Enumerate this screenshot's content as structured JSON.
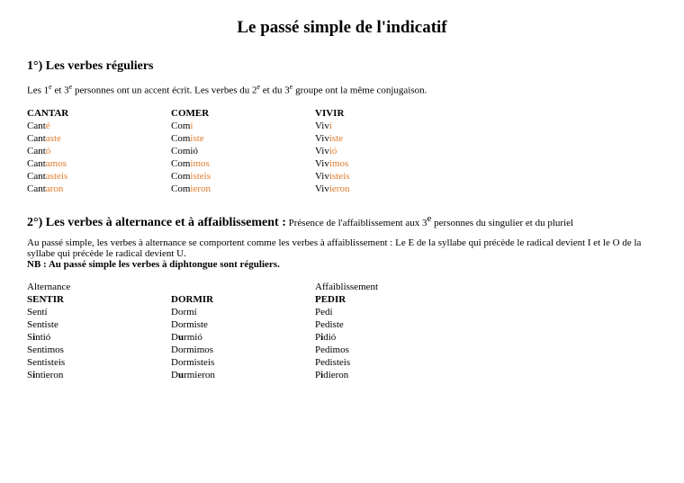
{
  "title": "Le passé simple de l'indicatif",
  "section1": {
    "heading": "1°) Les verbes réguliers",
    "intro_a": "Les 1",
    "intro_b": " et 3",
    "intro_c": " personnes ont un accent écrit. Les verbes du 2",
    "intro_d": " et du 3",
    "intro_e": " groupe ont la même conjugaison.",
    "sup_e": "e",
    "verbs": {
      "cantar": {
        "head": "CANTAR",
        "r1s": "Cant",
        "r1a": "é",
        "r2s": "Cant",
        "r2a": "aste",
        "r3s": "Cant",
        "r3a": "ó",
        "r4s": "Cant",
        "r4a": "amos",
        "r5s": "Cant",
        "r5a": "asteis",
        "r6s": "Cant",
        "r6a": "aron"
      },
      "comer": {
        "head": "COMER",
        "r1s": "Com",
        "r1a": "í",
        "r2s": "Com",
        "r2a": "iste",
        "r3s": "Comió",
        "r3a": "",
        "r4s": "Com",
        "r4a": "imos",
        "r5s": "Com",
        "r5a": "isteis",
        "r6s": "Com",
        "r6a": "ieron"
      },
      "vivir": {
        "head": "VIVIR",
        "r1s": "Viv",
        "r1a": "í",
        "r2s": "Viv",
        "r2a": "iste",
        "r3s": "Viv",
        "r3a": "ió",
        "r4s": "Viv",
        "r4a": "imos",
        "r5s": "Viv",
        "r5a": "isteis",
        "r6s": "Viv",
        "r6a": "ieron"
      }
    }
  },
  "section2": {
    "heading": "2°) Les verbes à alternance et à affaiblissement :",
    "sub_a": " Présence de l'affaiblissement aux 3",
    "sub_b": " personnes du singulier et du pluriel",
    "para": "Au passé simple, les verbes à alternance se comportent comme les verbes à affaiblissement : Le E de la syllabe qui précède le radical devient I et le O de la syllabe qui précède le radical devient U.",
    "nb": "NB : Au passé simple les verbes à diphtongue sont réguliers.",
    "col1_label": "Alternance",
    "col3_label": "Affaiblissement",
    "verbs": {
      "sentir": {
        "head": "SENTIR",
        "r1": "Sentí",
        "r2": "Sentiste",
        "r3a": "S",
        "r3b": "i",
        "r3c": "ntió",
        "r4": "Sentimos",
        "r5": "Sentisteis",
        "r6a": "S",
        "r6b": "i",
        "r6c": "ntieron"
      },
      "dormir": {
        "head": "DORMIR",
        "r1": "Dormí",
        "r2": "Dormiste",
        "r3a": "D",
        "r3b": "u",
        "r3c": "rmió",
        "r4": "Dormimos",
        "r5": "Dormisteis",
        "r6a": "D",
        "r6b": "u",
        "r6c": "rmieron"
      },
      "pedir": {
        "head": "PEDIR",
        "r1": "Pedí",
        "r2": "Pediste",
        "r3a": "P",
        "r3b": "i",
        "r3c": "dió",
        "r4": "Pedimos",
        "r5": "Pedisteis",
        "r6a": "P",
        "r6b": "i",
        "r6c": "dieron"
      }
    }
  }
}
